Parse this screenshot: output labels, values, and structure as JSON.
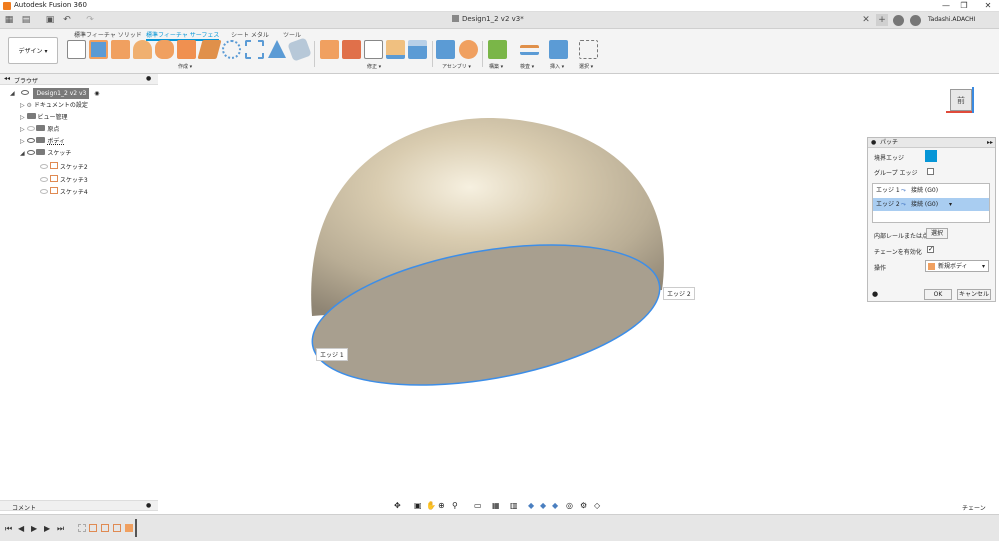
{
  "window": {
    "title": "Autodesk Fusion 360"
  },
  "document": {
    "name": "Design1_2 v2 v3*"
  },
  "user": {
    "name": "Tadashi.ADACHI"
  },
  "workspace": {
    "label": "デザイン ▾"
  },
  "toolbar": {
    "tabs": [
      "標準フィーチャ ソリッド",
      "標準フィーチャ サーフェス",
      "シート メタル",
      "ツール"
    ],
    "active_tab": 1,
    "groups": [
      "作成 ▾",
      "修正 ▾",
      "アセンブリ ▾",
      "構築 ▾",
      "検査 ▾",
      "挿入 ▾",
      "選択 ▾"
    ]
  },
  "browser": {
    "header": "ブラウザ",
    "root": "Design1_2 v2 v3",
    "items": [
      "ドキュメントの設定",
      "ビュー管理",
      "原点",
      "ボディ",
      "スケッチ"
    ],
    "sketches": [
      "スケッチ2",
      "スケッチ3",
      "スケッチ4"
    ]
  },
  "viewcube": {
    "label": "前"
  },
  "viewport": {
    "edge1_label": "エッジ 1",
    "edge2_label": "エッジ 2"
  },
  "patch_panel": {
    "title": "パッチ",
    "boundary_edges_label": "境界エッジ",
    "group_edges_label": "グループ エッジ",
    "edge_rows": [
      {
        "name": "エッジ 1",
        "continuity": "接続 (G0)"
      },
      {
        "name": "エッジ 2",
        "continuity": "接続 (G0)"
      }
    ],
    "interior_rails_label": "内部レールまたは点",
    "select_label": "選択",
    "chain_label": "チェーンを有効化",
    "operation_label": "操作",
    "operation_value": "新規ボディ",
    "ok": "OK",
    "cancel": "キャンセル"
  },
  "comment": {
    "label": "コメント"
  },
  "status": {
    "label": "チェーン"
  },
  "colors": {
    "accent": "#0696d7",
    "highlight": "#a9cdf1",
    "face": "#a89f8f",
    "edge": "#3d8ee8"
  },
  "icons": [
    "grid-icon",
    "file-icon",
    "save-icon",
    "undo-icon",
    "redo-icon",
    "plus-icon",
    "clock-icon",
    "help-icon",
    "info-icon",
    "pin-icon"
  ]
}
